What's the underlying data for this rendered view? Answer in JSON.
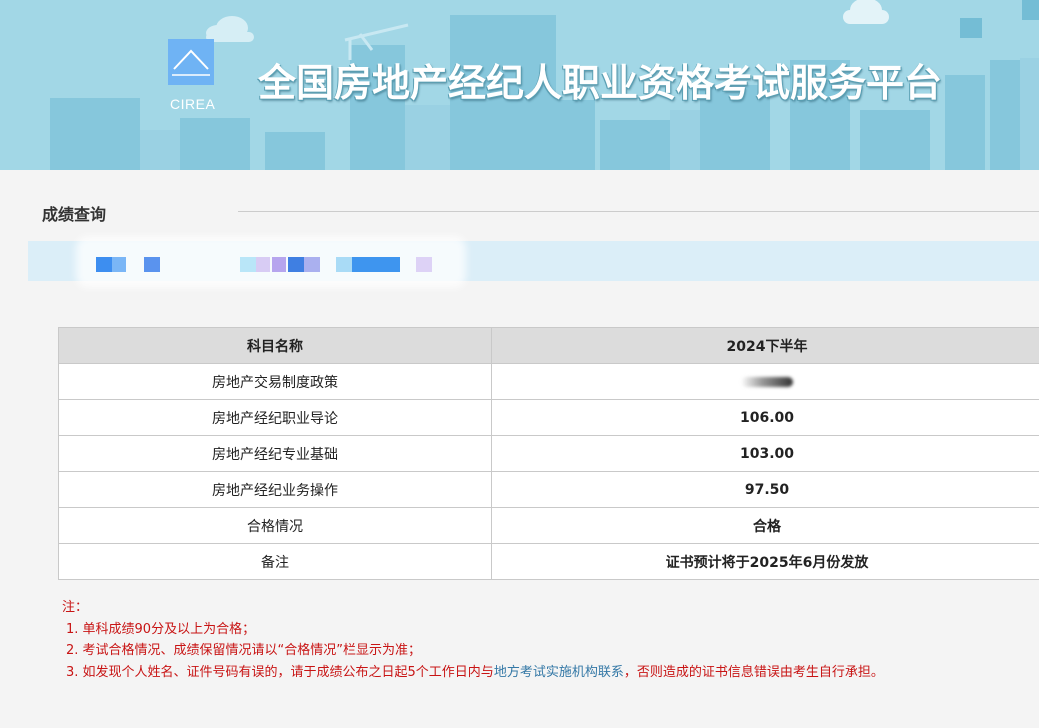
{
  "header": {
    "logo_text": "CIREA",
    "title": "全国房地产经纪人职业资格考试服务平台",
    "colors": {
      "sky": "#a2d7e6",
      "building": "#7fc3da",
      "logo": "#6fb3f4"
    }
  },
  "section": {
    "title": "成绩查询"
  },
  "table": {
    "headers": [
      "科目名称",
      "2024下半年"
    ],
    "rows": [
      {
        "name": "房地产交易制度政策",
        "value": ""
      },
      {
        "name": "房地产经纪职业导论",
        "value": "106.00"
      },
      {
        "name": "房地产经纪专业基础",
        "value": "103.00"
      },
      {
        "name": "房地产经纪业务操作",
        "value": "97.50"
      },
      {
        "name": "合格情况",
        "value": "合格"
      },
      {
        "name": "备注",
        "value": "证书预计将于2025年6月份发放"
      }
    ]
  },
  "notes": {
    "label": "注：",
    "item1": "1. 单科成绩90分及以上为合格；",
    "item2": "2. 考试合格情况、成绩保留情况请以“合格情况”栏显示为准；",
    "item3_prefix": "3. 如发现个人姓名、证件号码有误的，请于成绩公布之日起5个工作日内与",
    "item3_link": "地方考试实施机构联系",
    "item3_suffix": "，否则造成的证书信息错误由考生自行承担。"
  }
}
